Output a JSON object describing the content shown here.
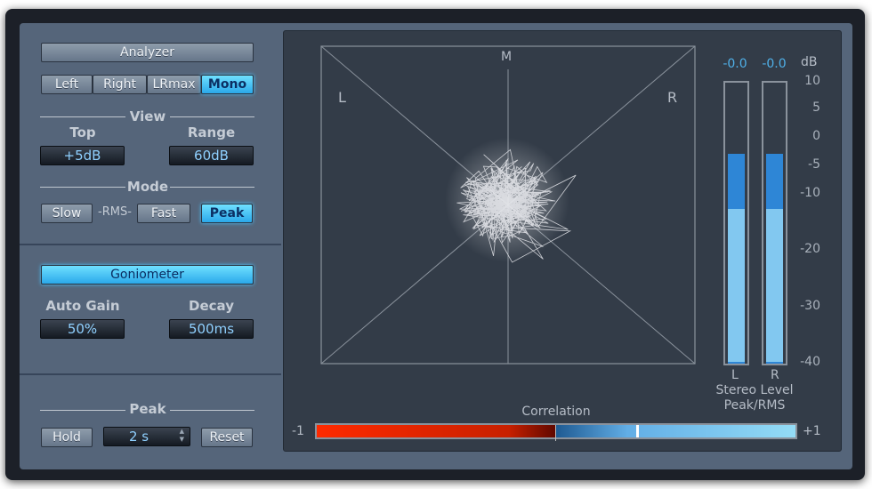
{
  "analyzer": {
    "label": "Analyzer",
    "channels": [
      "Left",
      "Right",
      "LRmax",
      "Mono"
    ],
    "selected_channel": "Mono"
  },
  "view": {
    "label": "View",
    "top_label": "Top",
    "top_value": "+5dB",
    "range_label": "Range",
    "range_value": "60dB"
  },
  "mode": {
    "label": "Mode",
    "slow": "Slow",
    "rms": "-RMS-",
    "fast": "Fast",
    "peak": "Peak",
    "selected": "Peak"
  },
  "goniometer": {
    "label": "Goniometer",
    "auto_gain_label": "Auto Gain",
    "auto_gain_value": "50%",
    "decay_label": "Decay",
    "decay_value": "500ms",
    "m": "M",
    "l": "L",
    "r": "R"
  },
  "peak": {
    "label": "Peak",
    "hold": "Hold",
    "hold_time": "2 s",
    "reset": "Reset"
  },
  "meter": {
    "left_readout": "-0.0",
    "right_readout": "-0.0",
    "unit": "dB",
    "scale": [
      "10",
      "5",
      "0",
      "-5",
      "-10",
      "-20",
      "-30",
      "-40"
    ],
    "left_label": "L",
    "right_label": "R",
    "title1": "Stereo Level",
    "title2": "Peak/RMS",
    "left_peak_db": -3,
    "left_rms_db": -13,
    "right_peak_db": -3,
    "right_rms_db": -13
  },
  "correlation": {
    "label": "Correlation",
    "min": "-1",
    "max": "+1",
    "value": 0.35
  },
  "colors": {
    "accent": "#2aa8ea",
    "meter_peak": "#2e86d6",
    "meter_rms": "#82c8f0"
  }
}
